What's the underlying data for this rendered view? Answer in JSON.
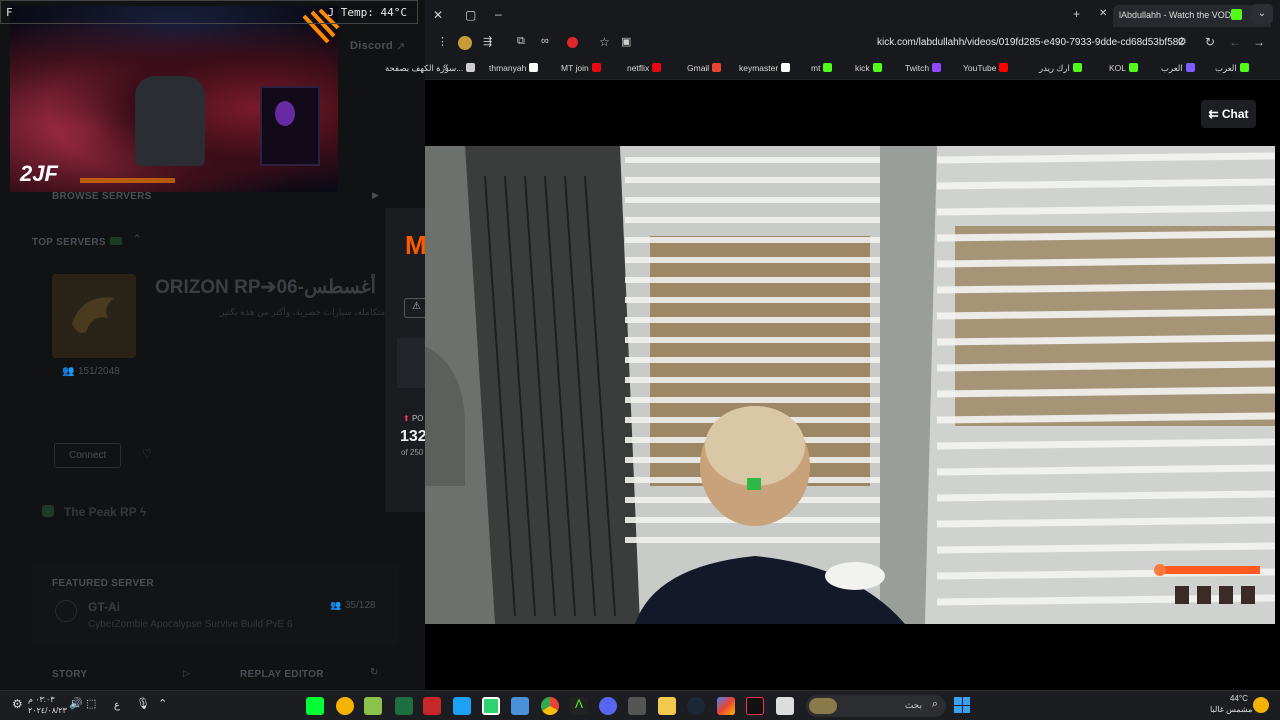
{
  "left_app": {
    "discord_label": "Discord",
    "browse_servers": "BROWSE SERVERS",
    "top_servers": "TOP SERVERS",
    "server_name": "ORIZON RP➔أغسطس-06",
    "server_desc": "خريطة متكاملة، سيارات حصرية، وأكثر من هذه بكثير!",
    "player_count": "151/2048",
    "connect_label": "Connect",
    "second_server": "The Peak RP ϟ",
    "featured_server": "FEATURED SERVER",
    "featured_name": "GT-Ai",
    "featured_count": "35/128",
    "featured_desc": "CyberZombie Apocalypse Survive Build PvE 6",
    "story_label": "STORY",
    "replay_editor": "REPLAY EDITOR",
    "modal_po": "PO",
    "modal_count": "132",
    "modal_of": "of 250"
  },
  "overlay": {
    "temp": "J Temp: 44°C",
    "f": "F"
  },
  "browser": {
    "tab_title": "lAbdullahh - Watch the VOD",
    "url": "kick.com/labdullahh/videos/019fd285-e490-7933-9dde-cd68d53bf582",
    "chat_label": "Chat",
    "bookmarks": [
      {
        "label": "العرب",
        "color": "#53fc18"
      },
      {
        "label": "العرب",
        "color": "#7a5cff"
      },
      {
        "label": "KOL",
        "color": "#53fc18"
      },
      {
        "label": "ارك ريدر",
        "color": "#53fc18"
      },
      {
        "label": "YouTube",
        "color": "#ff0000"
      },
      {
        "label": "Twitch",
        "color": "#9146ff"
      },
      {
        "label": "kick",
        "color": "#53fc18"
      },
      {
        "label": "mt",
        "color": "#53fc18"
      },
      {
        "label": "keymaster",
        "color": "#ffffff"
      },
      {
        "label": "Gmail",
        "color": "#ea4335"
      },
      {
        "label": "netflix",
        "color": "#e50914"
      },
      {
        "label": "MT join",
        "color": "#e50914"
      },
      {
        "label": "thmanyah",
        "color": "#ffffff"
      },
      {
        "label": "سورة الكهف بصفحة...",
        "color": "#cccccc"
      }
    ]
  },
  "taskbar": {
    "search_placeholder": "بحث",
    "weather_temp": "44°C",
    "weather_desc": "مشمس غالبا",
    "time": "٠٣:٠٣ م",
    "date": "٢٠٢٤/٠٨/٢٣",
    "lang": "ع"
  },
  "colors": {
    "kick_green": "#53fc18",
    "accent_orange": "#ff6a00"
  }
}
